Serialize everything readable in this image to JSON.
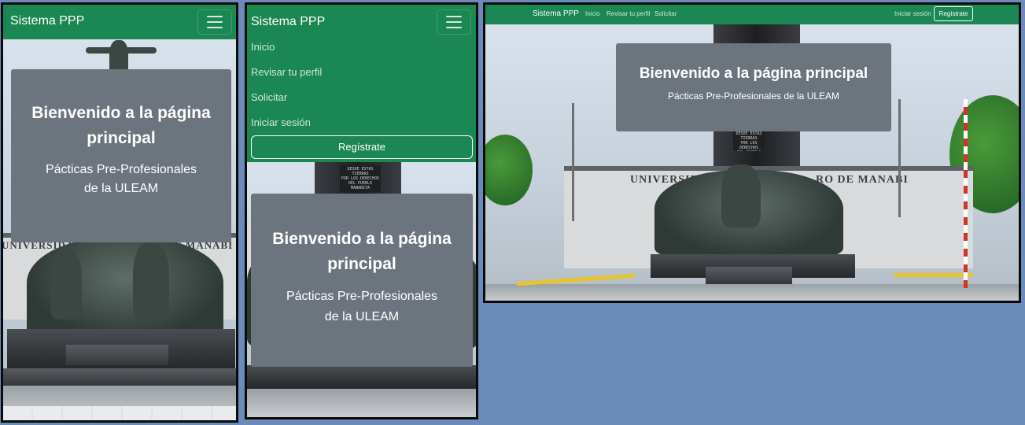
{
  "app": {
    "brand": "Sistema PPP",
    "hero_title": "Bienvenido a la página principal",
    "hero_subtitle": "Pácticas Pre-Profesionales de la ULEAM"
  },
  "nav": {
    "links": [
      "Inicio",
      "Revisar tu perfil",
      "Solicitar",
      "Iniciar sesión"
    ],
    "register": "Regístrate"
  },
  "scenery": {
    "wall_text": "UNIVERSIDAD ... RO DE MANABÍ",
    "wall_left": "UNIVERSIDAD",
    "wall_right": "RO DE MANABI",
    "plaque_lines": [
      "DESDE ESTAS TIERRAS",
      "POR LOS DERECHOS",
      "DEL PUEBLO",
      "MANABITA"
    ]
  },
  "colors": {
    "navbar": "#1b8752",
    "hero": "#6c757d",
    "background": "#6b8cba"
  }
}
